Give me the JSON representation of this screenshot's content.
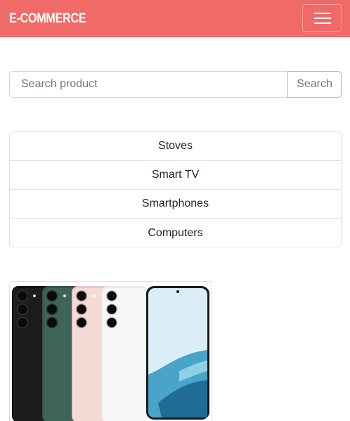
{
  "navbar": {
    "brand": "E-COMMERCE",
    "menu_icon": "hamburger-menu-icon"
  },
  "search": {
    "placeholder": "Search product",
    "button_label": "Search"
  },
  "categories": [
    {
      "label": "Stoves"
    },
    {
      "label": "Smart TV"
    },
    {
      "label": "Smartphones"
    },
    {
      "label": "Computers"
    }
  ],
  "product": {
    "image": "smartphone-lineup-image",
    "colors": [
      "#111111",
      "#3a5a50",
      "#f0d6d0",
      "#f4f4f4"
    ]
  },
  "theme": {
    "accent": "#f06a68"
  }
}
